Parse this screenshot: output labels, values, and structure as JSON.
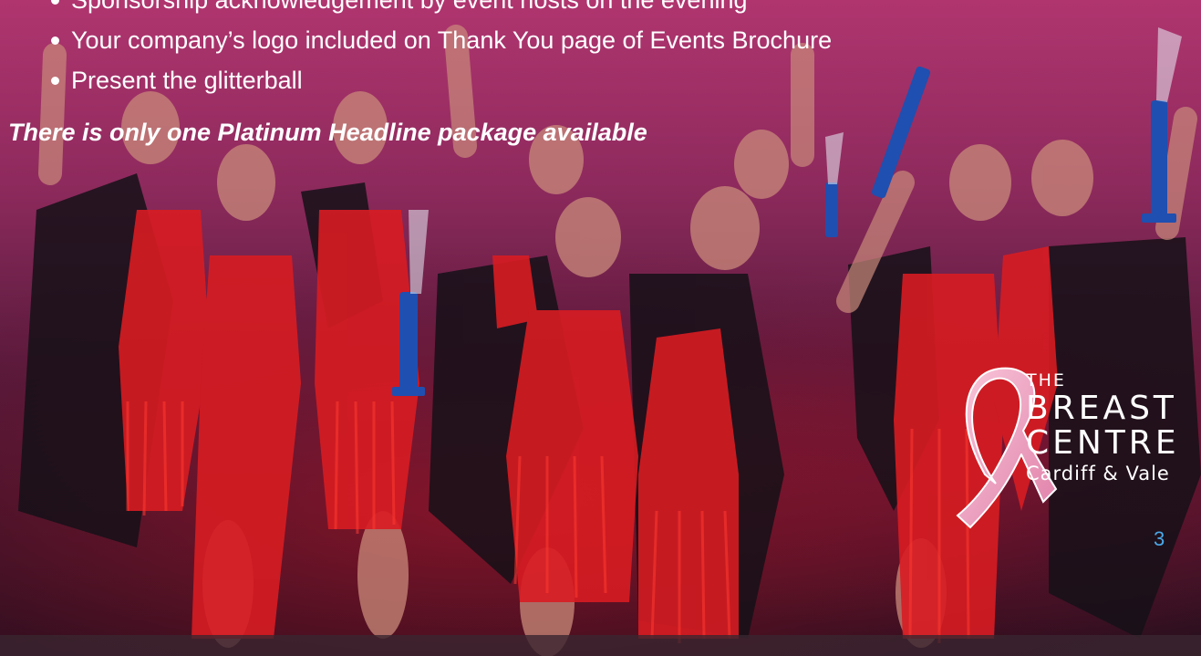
{
  "bullets": [
    "Sponsorship acknowledgement by event hosts on the evening",
    "Your company’s logo included on Thank You page of Events Brochure",
    "Present the glitterball"
  ],
  "note": "There is only one Platinum Headline package available",
  "logo": {
    "line1": "THE",
    "line2": "BREAST",
    "line3": "CENTRE",
    "line4": "Cardiff & Vale",
    "icon": "pink-ribbon-icon"
  },
  "page_number": "3",
  "colors": {
    "overlay_top": "#b0356f",
    "overlay_bottom": "#2a0f1d",
    "costume_red": "#d81c22",
    "robe_black": "#151018",
    "trophy_blue": "#1f4fb0",
    "ribbon_pink": "#f3a6c4",
    "page_number": "#4aa8e8"
  }
}
